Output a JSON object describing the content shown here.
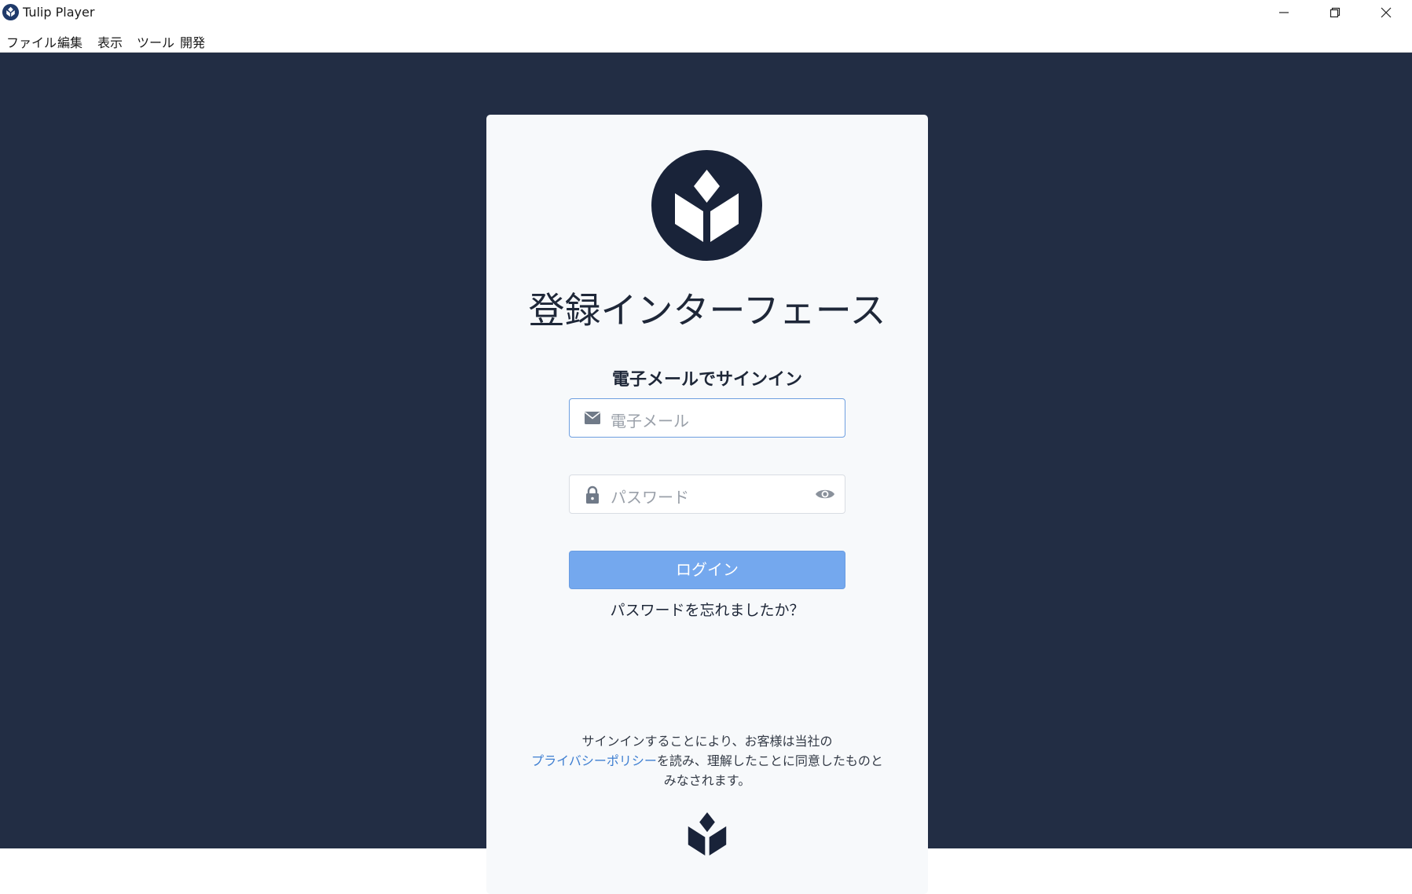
{
  "window": {
    "title": "Tulip Player",
    "controls": [
      "minimize",
      "restore",
      "close"
    ]
  },
  "menu": {
    "items": [
      "ファイル",
      "編集",
      "表示",
      "ツール",
      "開発"
    ]
  },
  "login": {
    "heading": "登録インターフェース",
    "subheading": "電子メールでサインイン",
    "email_placeholder": "電子メール",
    "password_placeholder": "パスワード",
    "login_button": "ログイン",
    "forgot_link": "パスワードを忘れましたか？",
    "legal": {
      "line1": "サインインすることにより、お客様は当社の",
      "link": "プライバシーポリシー",
      "line2_rest": "を読み、理解したことに同意したものと",
      "line3": "みなされます。"
    }
  },
  "colors": {
    "background": "#222d44",
    "card": "#f7f9fb",
    "logo": "#192339",
    "button": "#74a8ee",
    "link": "#3f7fd1",
    "focus_border": "#6e9fe0"
  },
  "icons": {
    "app": "tulip-icon",
    "email": "envelope-icon",
    "password": "lock-icon",
    "visibility": "eye-icon"
  }
}
